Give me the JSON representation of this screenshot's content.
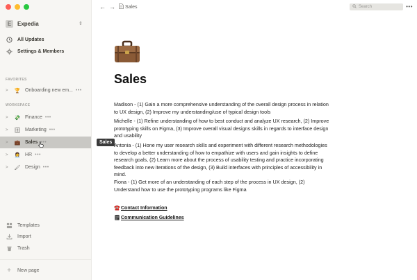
{
  "workspace": {
    "initial": "E",
    "name": "Expedia"
  },
  "sidebar": {
    "nav": [
      {
        "label": "All Updates",
        "icon": "clock-icon"
      },
      {
        "label": "Settings & Members",
        "icon": "gear-icon"
      }
    ],
    "favorites_label": "FAVORITES",
    "favorites": [
      {
        "label": "Onboarding new em...",
        "emoji": "🏆"
      }
    ],
    "workspace_label": "WORKSPACE",
    "pages": [
      {
        "label": "Finance",
        "emoji": "💸"
      },
      {
        "label": "Marketing",
        "emoji": "🗄"
      },
      {
        "label": "Sales",
        "emoji": "💼"
      },
      {
        "label": "HR",
        "emoji": "👩‍💼"
      },
      {
        "label": "Design",
        "emoji": "🖌"
      }
    ],
    "bottom": [
      {
        "label": "Templates",
        "icon": "templates-icon"
      },
      {
        "label": "Import",
        "icon": "import-icon"
      },
      {
        "label": "Trash",
        "icon": "trash-icon"
      }
    ],
    "new_page_label": "New page",
    "tooltip": "Sales"
  },
  "topbar": {
    "breadcrumb": "Sales",
    "search_placeholder": "Search"
  },
  "main": {
    "title": "Sales",
    "paragraphs": [
      "Madison - (1) Gain a more comprehensive understanding of the overall design process in relation to UX design, (2) Improve my understanding/use of typical design tools",
      "Michelle - (1) Refine understanding of how to best conduct and analyze UX research, (2) Improve prototyping skills on Figma, (3) Improve overall visual designs skills in regards to interface design and usability",
      "Antonia - (1) Hone my user research skills and experiment with different research methodologies to develop a better understanding of how to empathize with users and gain insights to define research goals, (2) Learn more about the process of usability testing and practice incorporating feedback into new iterations of the design, (3) Build interfaces with principles of accessibility in mind.",
      "Fiona - (1) Get more of an understanding of each step of the process in UX design, (2) Understand how to use the prototyping programs like Figma"
    ],
    "links": [
      {
        "label": "Contact Information",
        "emoji": "☎️"
      },
      {
        "label": "Communication Guidelines",
        "emoji": "🗒"
      }
    ]
  },
  "colors": {
    "sidebar_bg": "#f7f6f3",
    "active_item_bg": "#c9c8c4",
    "text": "#37352f"
  }
}
